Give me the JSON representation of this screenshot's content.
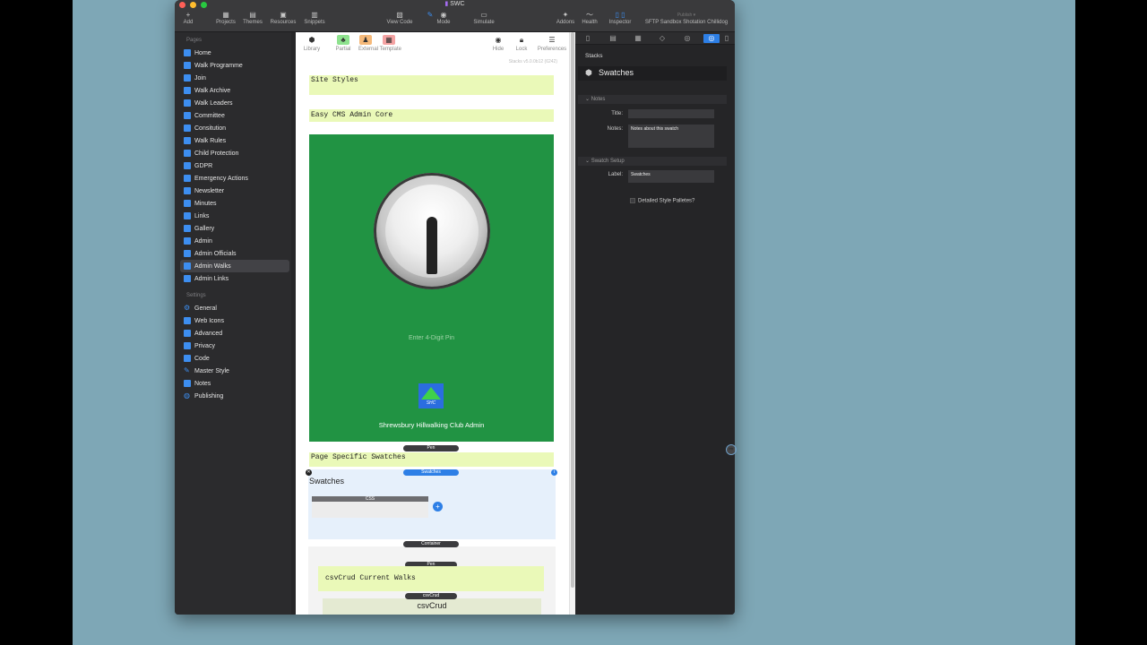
{
  "window": {
    "title": "SWC",
    "colors": {
      "close": "#fe5f57",
      "minimize": "#febc2e",
      "zoom": "#28c840"
    }
  },
  "toolbar": {
    "add": "Add",
    "projects": "Projects",
    "themes": "Themes",
    "resources": "Resources",
    "snippets": "Snippets",
    "view_code": "View Code",
    "mode": "Mode",
    "simulate": "Simulate",
    "addons": "Addons",
    "health": "Health",
    "inspector": "Inspector",
    "publish_target": "SFTP Sandbox Shotation Chillidog",
    "publish": "Publish"
  },
  "sidebar": {
    "pages_header": "Pages",
    "pages": [
      "Home",
      "Walk Programme",
      "Join",
      "Walk Archive",
      "Walk Leaders",
      "Committee",
      "Consitution",
      "Walk Rules",
      "Child Protection",
      "GDPR",
      "Emergency Actions",
      "Newsletter",
      "Minutes",
      "Links",
      "Gallery",
      "Admin",
      "Admin Officials",
      "Admin Walks",
      "Admin Links"
    ],
    "selected_page": "Admin Walks",
    "settings_header": "Settings",
    "settings": [
      "General",
      "Web Icons",
      "Advanced",
      "Privacy",
      "Code",
      "Master Style",
      "Notes",
      "Publishing"
    ]
  },
  "editor": {
    "library": "Library",
    "partial": "Partial",
    "external_template": "External Template",
    "hide": "Hide",
    "lock": "Lock",
    "preferences": "Preferences",
    "version": "Stacks v5.0.0b12 (6242)",
    "site_styles": "Site Styles",
    "easy_cms": "Easy CMS Admin Core",
    "pin_placeholder": "Enter 4-Digit Pin",
    "logo_text": "SHC",
    "club_name": "Shrewsbury Hillwalking Club Admin",
    "pen_pill_1": "Pen",
    "page_specific": "Page Specific Swatches",
    "swatches_pill": "Swatches",
    "swatches_title": "Swatches",
    "css_label": "CSS",
    "container_pill": "Container",
    "pen_pill_2": "Pen",
    "csvcrud_block": "csvCrud Current Walks",
    "csvcrud_pill": "csvCrud",
    "csvcrud_title": "csvCrud"
  },
  "inspector": {
    "stacks_label": "Stacks",
    "stack_name": "Swatches",
    "notes_group": "Notes",
    "title_label": "Title:",
    "title_value": "",
    "notes_label": "Notes:",
    "notes_value": "Notes about this swatch",
    "setup_group": "Swatch Setup",
    "label_label": "Label:",
    "label_value": "Swatches",
    "detailed_checkbox": "Detailed Style Palletes?"
  }
}
